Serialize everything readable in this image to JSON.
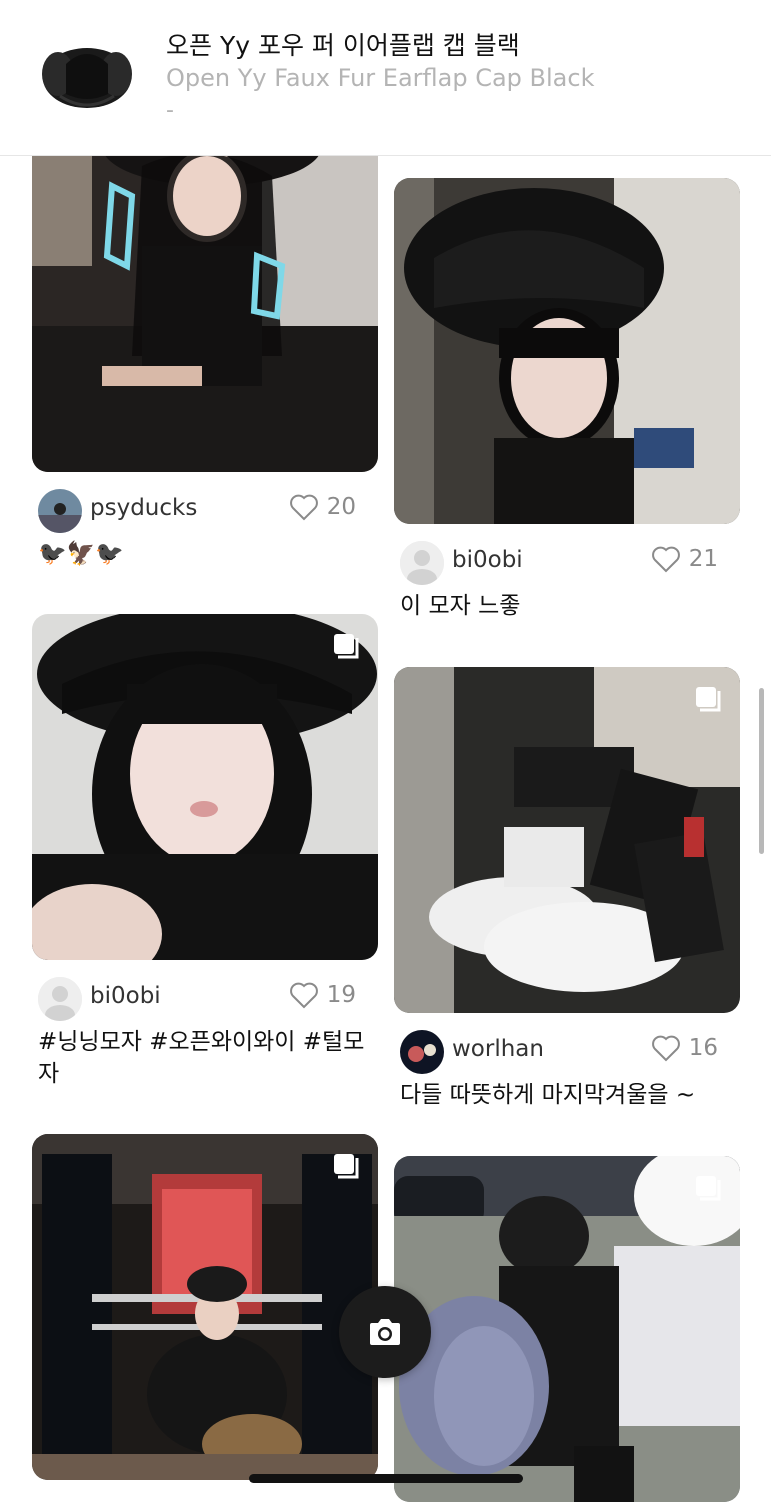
{
  "product": {
    "title": "오픈 Yy 포우 퍼 이어플랩 캡 블랙",
    "subtitle": "Open Yy Faux Fur Earflap Cap Black",
    "price": "-"
  },
  "posts": [
    {
      "username": "psyducks",
      "likes": "20",
      "caption": "🐦‍⬛🦅🐦‍⬛",
      "multi": false
    },
    {
      "username": "bi0obi",
      "likes": "21",
      "caption": "이 모자 느좋",
      "multi": false
    },
    {
      "username": "bi0obi",
      "likes": "19",
      "caption": "#닝닝모자 #오픈와이와이 #털모자",
      "multi": true
    },
    {
      "username": "worlhan",
      "likes": "16",
      "caption": "다들 따뜻하게 마지막겨울을 ~",
      "multi": true
    },
    {
      "username": "",
      "likes": "",
      "caption": "",
      "multi": true
    },
    {
      "username": "",
      "likes": "",
      "caption": "",
      "multi": true
    }
  ],
  "icons": {
    "like": "heart-outline-icon",
    "camera": "camera-icon",
    "multi_photo": "multi-photo-icon"
  },
  "colors": {
    "text": "#111111",
    "muted": "#b4b4b4",
    "fab": "#1c1c1c"
  }
}
